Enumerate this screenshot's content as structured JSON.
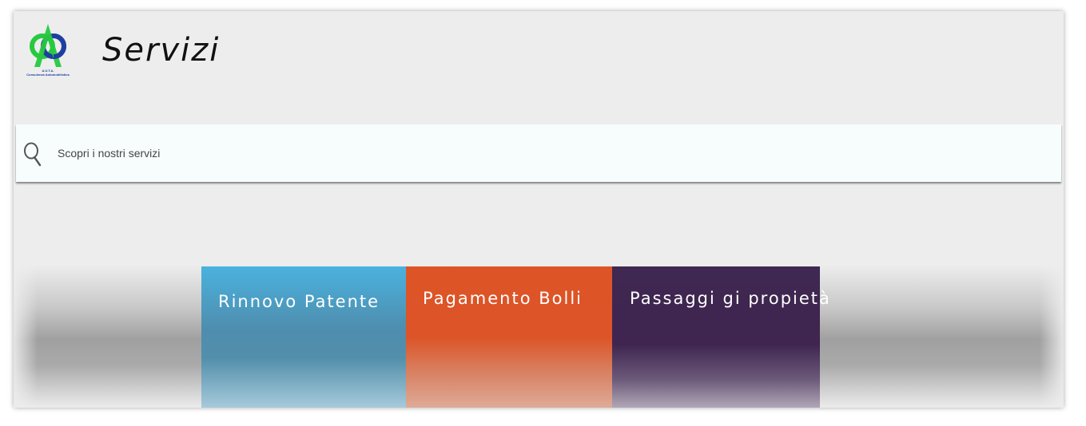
{
  "header": {
    "title": "Servizi",
    "logo": {
      "icon": "company-logo-icon",
      "caption_line1": "A.U.T.A.",
      "caption_line2": "Consulenza Automobilistica",
      "colors": {
        "green": "#27c93f",
        "blue": "#1e3fa0"
      }
    }
  },
  "search": {
    "placeholder": "Scopri i nostri servizi",
    "value": "",
    "icon": "search-icon"
  },
  "services": [
    {
      "label": "Rinnovo Patente",
      "color": "#4ab2de"
    },
    {
      "label": "Pagamento Bolli",
      "color": "#dd5527"
    },
    {
      "label": "Passaggi gi propietà",
      "color": "#3f2851"
    }
  ]
}
